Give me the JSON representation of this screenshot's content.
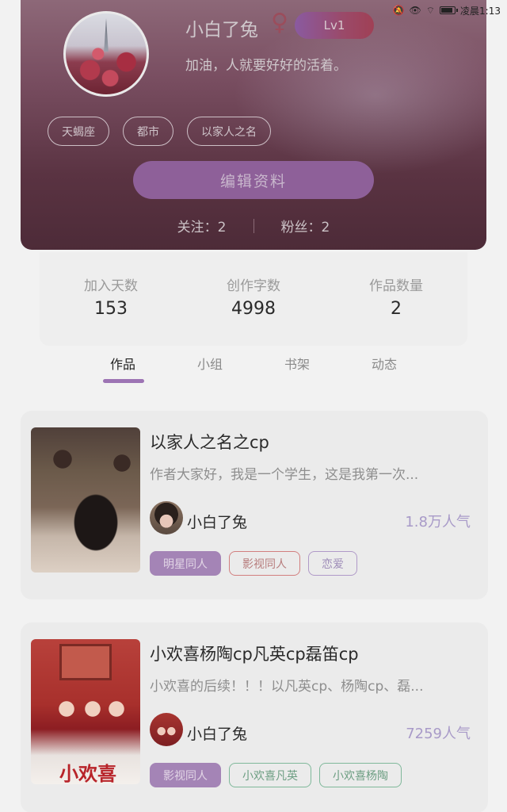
{
  "status_bar": {
    "icons": [
      "mute-icon",
      "eye-icon",
      "wifi-icon",
      "battery-icon"
    ],
    "time": "凌晨1:13"
  },
  "profile": {
    "username": "小白了兔",
    "gender_symbol": "♀",
    "level": "Lv1",
    "motto": "加油，人就要好好的活着。",
    "tags": [
      "天蝎座",
      "都市",
      "以家人之名"
    ],
    "edit_button": "编辑资料",
    "following": "关注：2",
    "followers": "粉丝：2"
  },
  "stats": [
    {
      "label": "加入天数",
      "value": "153"
    },
    {
      "label": "创作字数",
      "value": "4998"
    },
    {
      "label": "作品数量",
      "value": "2"
    }
  ],
  "tabs": [
    "作品",
    "小组",
    "书架",
    "动态"
  ],
  "works": [
    {
      "title": "以家人之名之cp",
      "description": "作者大家好，我是一个学生，这是我第一次...",
      "author": "小白了兔",
      "popularity": "1.8万人气",
      "tags": [
        "明星同人",
        "影视同人",
        "恋爱"
      ]
    },
    {
      "title": "小欢喜杨陶cp凡英cp磊笛cp",
      "description": "小欢喜的后续！！！以凡英cp、杨陶cp、磊...",
      "author": "小白了兔",
      "popularity": "7259人气",
      "cover_text": "小欢喜",
      "tags": [
        "影视同人",
        "小欢喜凡英",
        "小欢喜杨陶"
      ]
    }
  ]
}
